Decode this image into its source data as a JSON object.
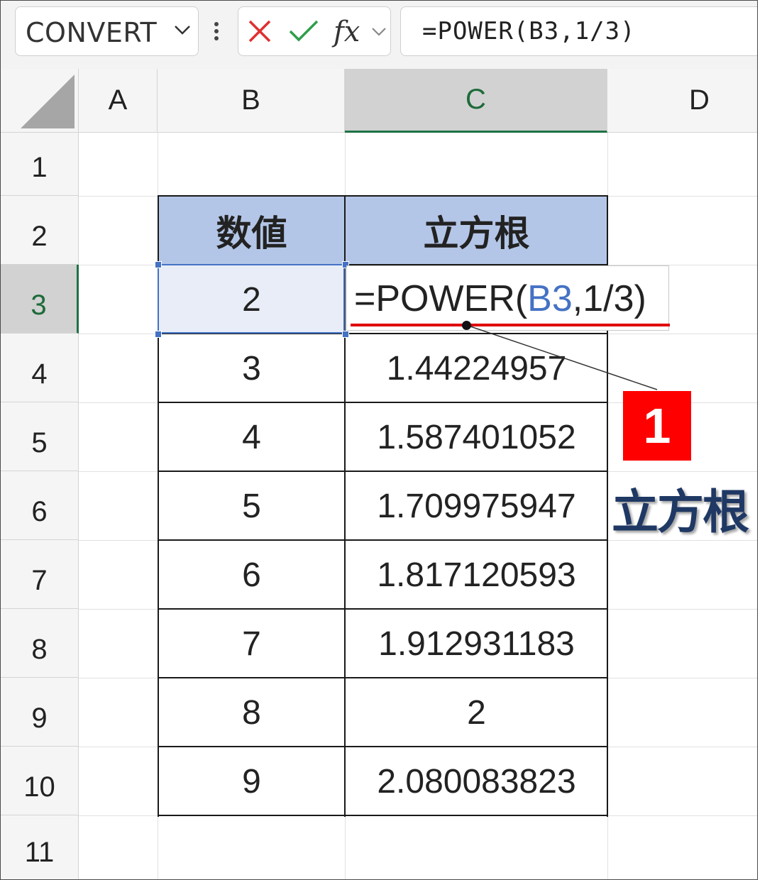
{
  "colors": {
    "header_fill": "#b4c6e7",
    "selection_blue": "#4472c4",
    "selected_header_green": "#1e7145",
    "badge_red": "#ff0000",
    "label_navy": "#1f3864"
  },
  "formula_bar": {
    "name_box": "CONVERT",
    "name_box_icon": "chevron-down-icon",
    "more_icon": "vertical-ellipsis-icon",
    "cancel_icon": "x-icon",
    "enter_icon": "checkmark-icon",
    "fx_label": "fx",
    "fx_dropdown_icon": "chevron-down-icon",
    "formula": "=POWER(B3,1/3)"
  },
  "columns": [
    "A",
    "B",
    "C",
    "D"
  ],
  "rows": [
    "1",
    "2",
    "3",
    "4",
    "5",
    "6",
    "7",
    "8",
    "9",
    "10",
    "11"
  ],
  "table": {
    "headers": [
      "数値",
      "立方根"
    ],
    "rows": [
      {
        "value": "2",
        "result": ""
      },
      {
        "value": "3",
        "result": "1.44224957"
      },
      {
        "value": "4",
        "result": "1.587401052"
      },
      {
        "value": "5",
        "result": "1.709975947"
      },
      {
        "value": "6",
        "result": "1.817120593"
      },
      {
        "value": "7",
        "result": "1.912931183"
      },
      {
        "value": "8",
        "result": "2"
      },
      {
        "value": "9",
        "result": "2.080083823"
      }
    ]
  },
  "editing_cell": {
    "prefix": "=POWER(",
    "ref": "B3",
    "suffix": ",1/3)"
  },
  "annotation": {
    "badge": "1",
    "label": "立方根"
  }
}
